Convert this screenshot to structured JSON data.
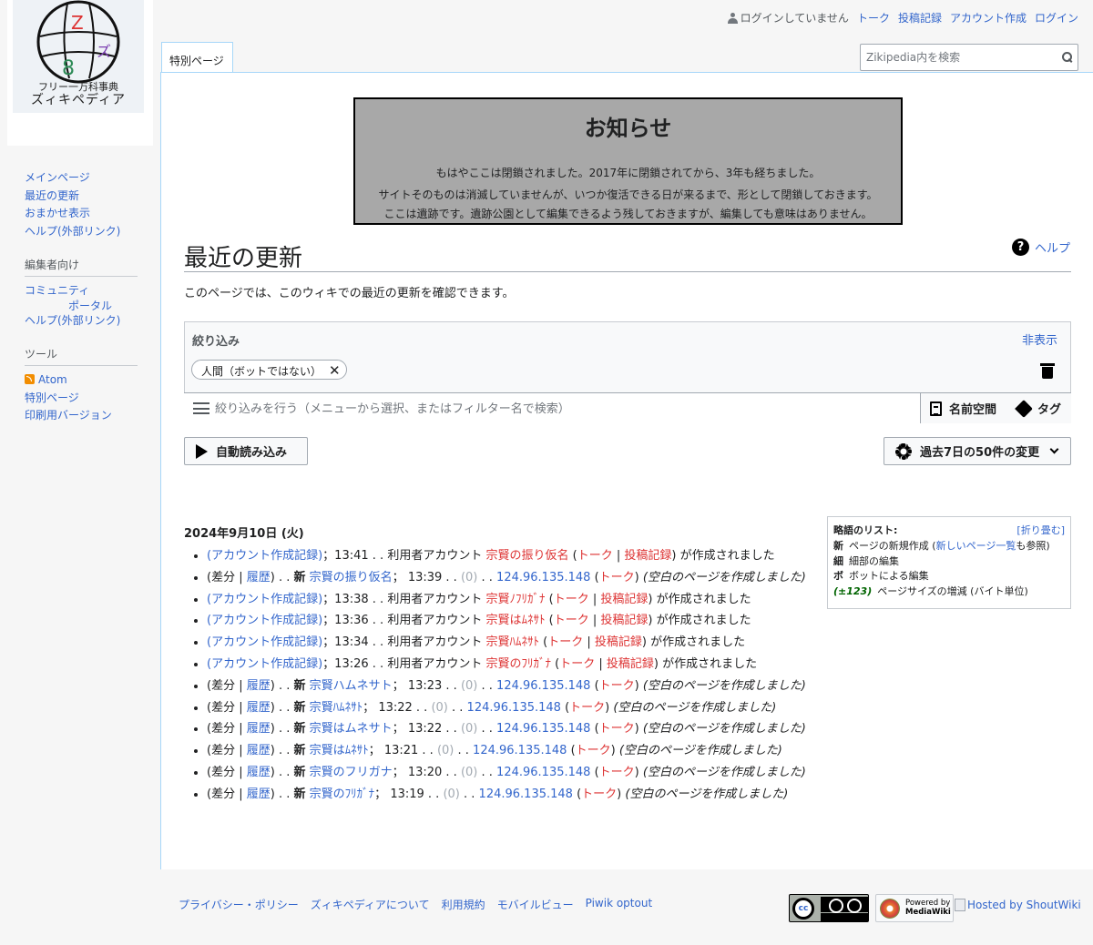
{
  "logo": {
    "line1": "フリー一万科事典",
    "line2": "ズィキペディア",
    "letter_z": "Z",
    "letter_small": "ズ",
    "glyph": "8"
  },
  "sidebar": {
    "nav": [
      "メインページ",
      "最近の更新",
      "おまかせ表示",
      "ヘルプ(外部リンク)"
    ],
    "editors_heading": "編集者向け",
    "editors": {
      "community_a": "コミュニティ",
      "community_b": "ポータル",
      "help": "ヘルプ(外部リンク)"
    },
    "tools_heading": "ツール",
    "tools": [
      "Atom",
      "特別ページ",
      "印刷用バージョン"
    ]
  },
  "personal": {
    "not_logged_in": "ログインしていません",
    "links": [
      "トーク",
      "投稿記録",
      "アカウント作成",
      "ログイン"
    ]
  },
  "tab_special": "特別ページ",
  "search": {
    "placeholder": "Zikipedia内を検索"
  },
  "notice": {
    "title": "お知らせ",
    "line1": "もはやここは閉鎖されました。2017年に閉鎖されてから、3年も経ちました。",
    "line2": "サイトそのものは消滅していませんが、いつか復活できる日が来るまで、形として閉鎖しておきます。",
    "line3": "ここは遺跡です。遺跡公園として編集できるよう残しておきますが、編集しても意味はありません。"
  },
  "page": {
    "title": "最近の更新",
    "help": "ヘルプ",
    "intro": "このページでは、このウィキでの最近の更新を確認できます。"
  },
  "filters": {
    "label": "絞り込み",
    "hide": "非表示",
    "chip": "人間（ボットではない）",
    "placeholder": "絞り込みを行う（メニューから選択、またはフィルター名で検索）",
    "namespace": "名前空間",
    "tag": "タグ"
  },
  "buttons": {
    "live": "自動読み込み",
    "period": "過去7日の50件の変更"
  },
  "legend": {
    "title": "略語のリスト:",
    "toggle": "[折り畳む]",
    "new_abbr": "新",
    "new_text": "ページの新規作成 (",
    "new_link": "新しいページ一覧",
    "new_tail": "も参照)",
    "minor_abbr": "細",
    "minor_text": "細部の編集",
    "bot_abbr": "ボ",
    "bot_text": "ボットによる編集",
    "size_abbr": "(±123)",
    "size_text": "ページサイズの増減 (バイト単位)"
  },
  "changes": {
    "date": "2024年9月10日 (火)",
    "log_link": "(アカウント作成記録)",
    "user_account": "利用者アカウント",
    "created": "が作成されました",
    "diff": "差分",
    "history": "履歴",
    "new_flag": "新",
    "talk": "トーク",
    "contribs": "投稿記録",
    "ip": "124.96.135.148",
    "zero": "(0)",
    "summary": "(空白のページを作成しました)",
    "items": [
      {
        "kind": "log",
        "time": "13:41",
        "user": "宗賢の振り仮名"
      },
      {
        "kind": "edit",
        "time": "13:39",
        "page": "宗賢の振り仮名"
      },
      {
        "kind": "log",
        "time": "13:38",
        "user": "宗賢ﾉﾌﾘｶﾞﾅ"
      },
      {
        "kind": "log",
        "time": "13:36",
        "user": "宗賢はﾑﾈｻﾄ"
      },
      {
        "kind": "log",
        "time": "13:34",
        "user": "宗賢ﾊﾑﾈｻﾄ"
      },
      {
        "kind": "log",
        "time": "13:26",
        "user": "宗賢のﾌﾘｶﾞﾅ"
      },
      {
        "kind": "edit",
        "time": "13:23",
        "page": "宗賢ハムネサト"
      },
      {
        "kind": "edit",
        "time": "13:22",
        "page": "宗賢ﾊﾑﾈｻﾄ"
      },
      {
        "kind": "edit",
        "time": "13:22",
        "page": "宗賢はムネサト"
      },
      {
        "kind": "edit",
        "time": "13:21",
        "page": "宗賢はﾑﾈｻﾄ"
      },
      {
        "kind": "edit",
        "time": "13:20",
        "page": "宗賢のフリガナ"
      },
      {
        "kind": "edit",
        "time": "13:19",
        "page": "宗賢のﾌﾘｶﾞﾅ"
      }
    ]
  },
  "footer": {
    "links": [
      "プライバシー・ポリシー",
      "ズィキペディアについて",
      "利用規約",
      "モバイルビュー",
      "Piwik optout"
    ],
    "cc_text": "cc",
    "powered_line1": "Powered by",
    "powered_line2": "MediaWiki",
    "hosted": "Hosted by ShoutWiki"
  },
  "colors": {
    "link": "#3366cc",
    "redlink": "#d33",
    "notice_bg": "#a8a8a8",
    "border": "#a7d7f9"
  }
}
